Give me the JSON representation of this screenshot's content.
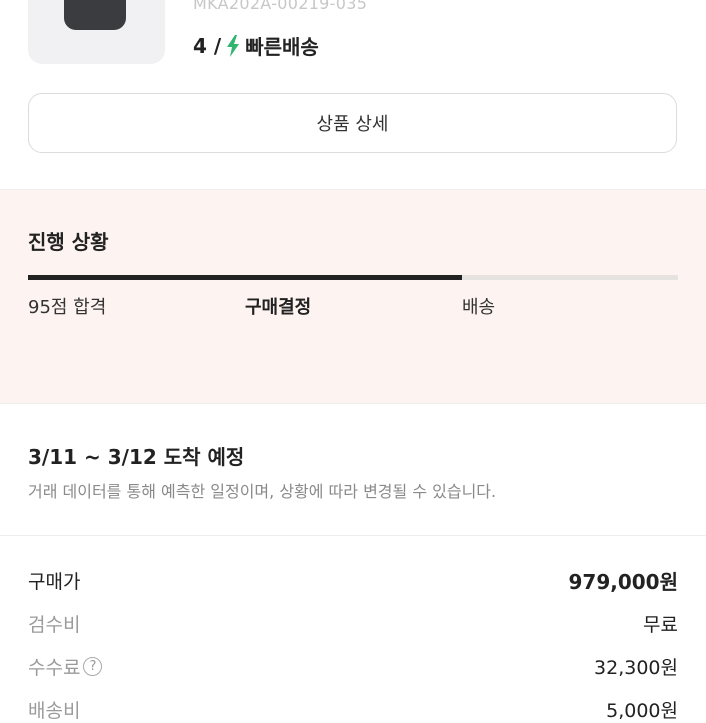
{
  "product": {
    "model_number": "MKA202A-00219-035",
    "size": "4 /",
    "shipping_label": "빠른배송",
    "shipping_icon": "lightning-bolt-icon",
    "shipping_color": "#31b46e"
  },
  "detail_button_label": "상품 상세",
  "progress": {
    "title": "진행 상황",
    "steps": [
      "95점 합격",
      "구매결정",
      "배송"
    ],
    "active_step": 1,
    "completion": 0.667,
    "bar_color": "#222222",
    "track_color": "#e6e2df"
  },
  "delivery": {
    "eta": "3/11 ~ 3/12 도착 예정",
    "note": "거래 데이터를 통해 예측한 일정이며, 상황에 따라 변경될 수 있습니다."
  },
  "pricing": [
    {
      "label": "구매가",
      "value": "979,000원"
    },
    {
      "label": "검수비",
      "value": "무료"
    },
    {
      "label": "수수료",
      "value": "32,300원"
    },
    {
      "label": "배송비",
      "value": "5,000원"
    }
  ]
}
